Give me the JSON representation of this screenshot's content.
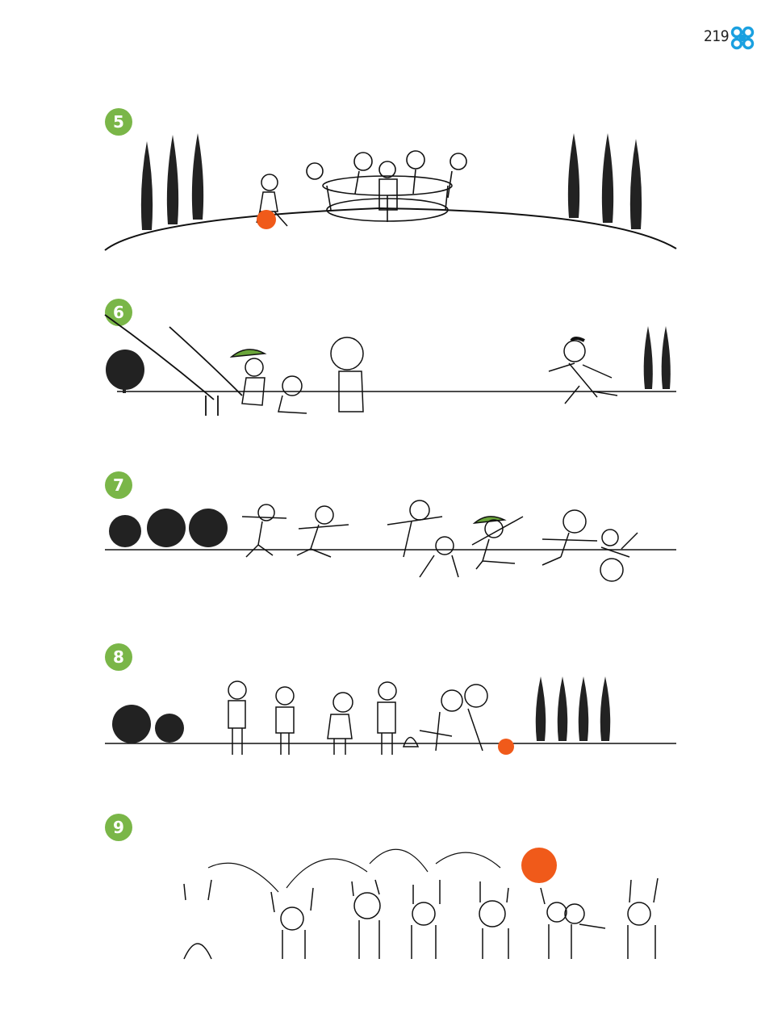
{
  "page": {
    "number": "219"
  },
  "logo": {
    "icon": "quatrefoil-logo-icon",
    "color": "#1aa0e0"
  },
  "colors": {
    "badge": "#7ab648",
    "ball": "#f05a1a",
    "cap": "#6aa53a",
    "ink": "#111111"
  },
  "panels": [
    {
      "number": "5"
    },
    {
      "number": "6"
    },
    {
      "number": "7"
    },
    {
      "number": "8"
    },
    {
      "number": "9"
    }
  ]
}
